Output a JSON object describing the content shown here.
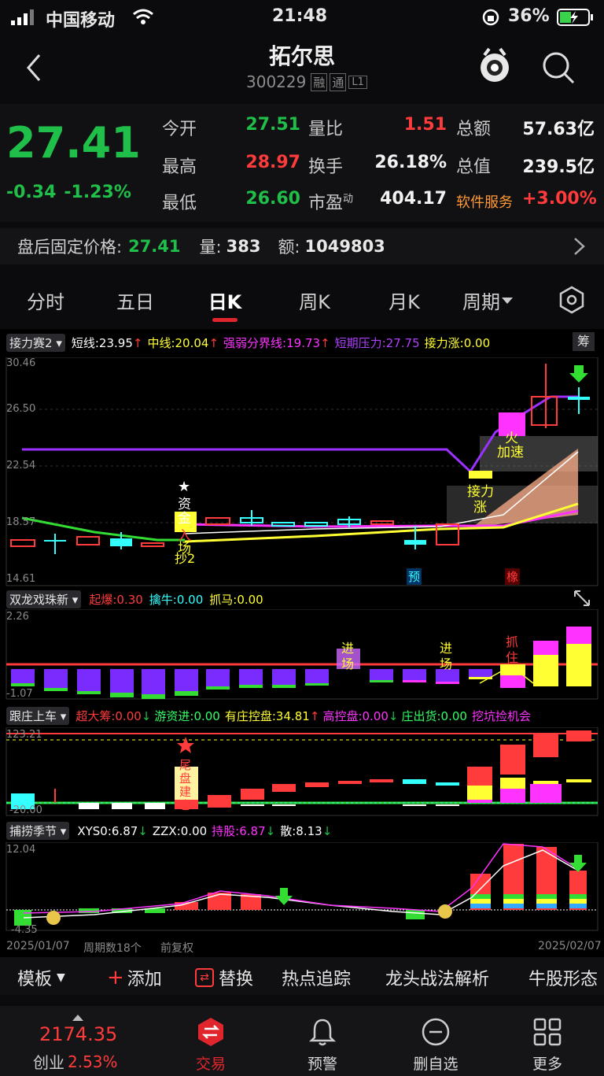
{
  "status_bar": {
    "carrier": "中国移动",
    "time": "21:48",
    "battery": "36%"
  },
  "header": {
    "title": "拓尔思",
    "code": "300229",
    "badges": [
      "融",
      "通",
      "L1"
    ]
  },
  "quote": {
    "price": "27.41",
    "change": "-0.34",
    "change_pct": "-1.23%",
    "fields": [
      {
        "label": "今开",
        "value": "27.51"
      },
      {
        "label": "量比",
        "value": "1.51"
      },
      {
        "label": "总额",
        "value": "57.63亿"
      },
      {
        "label": "最高",
        "value": "28.97"
      },
      {
        "label": "换手",
        "value": "26.18%"
      },
      {
        "label": "总值",
        "value": "239.5亿"
      },
      {
        "label": "最低",
        "value": "26.60"
      },
      {
        "label": "市盈",
        "label_sup": "动",
        "value": "404.17"
      },
      {
        "label": "软件服务",
        "value": "+3.00%"
      }
    ]
  },
  "after_hours": {
    "label": "盘后固定价格:",
    "price": "27.41",
    "vol_label": "量:",
    "vol": "383",
    "amt_label": "额:",
    "amt": "1049803"
  },
  "tabs": [
    "分时",
    "五日",
    "日K",
    "周K",
    "月K",
    "周期"
  ],
  "active_tab": "日K",
  "panel1": {
    "name": "接力赛2",
    "items": [
      {
        "label": "短线:",
        "value": "23.95",
        "arrow": "↑",
        "color": "#ffffff"
      },
      {
        "label": "中线:",
        "value": "20.04",
        "arrow": "↑",
        "color": "#ffff33"
      },
      {
        "label": "强弱分界线:",
        "value": "19.73",
        "arrow": "↑",
        "color": "#ff33ff"
      },
      {
        "label": "短期压力:",
        "value": "27.75",
        "arrow": "",
        "color": "#b040ff"
      },
      {
        "label": "接力涨:",
        "value": "0.00",
        "arrow": "",
        "color": "#ffff33"
      }
    ],
    "button": "筹",
    "y_labels": [
      "30.46",
      "26.50",
      "22.54",
      "18.57",
      "14.61"
    ],
    "annotations": {
      "star": "★",
      "zijin1": "资",
      "zijin2": "金",
      "rule1": "入",
      "rule2": "场",
      "buy": "抄2",
      "jieli1": "接力",
      "jieli2": "涨",
      "jiasu": "加速",
      "jiasu_top": "火",
      "yu": "预",
      "zhen": "橡"
    }
  },
  "panel2": {
    "name": "双龙戏珠新",
    "items": [
      {
        "label": "起爆:",
        "value": "0.30",
        "color": "#ff3b3b"
      },
      {
        "label": "擒牛:",
        "value": "0.00",
        "color": "#33ffff"
      },
      {
        "label": "抓马:",
        "value": "0.00",
        "color": "#ffff33"
      }
    ],
    "y_labels": [
      "2.26",
      "-1.07"
    ],
    "tags": [
      "进",
      "场",
      "进",
      "场",
      "抓",
      "住"
    ]
  },
  "panel3": {
    "name": "跟庄上车",
    "items": [
      {
        "label": "超大筹:",
        "value": "0.00",
        "arrow": "↓",
        "color": "#ff3b3b"
      },
      {
        "label": "游资进:",
        "value": "0.00",
        "arrow": "",
        "color": "#33ff66"
      },
      {
        "label": "有庄控盘:",
        "value": "34.81",
        "arrow": "↑",
        "color": "#ffff33"
      },
      {
        "label": "高控盘:",
        "value": "0.00",
        "arrow": "↓",
        "color": "#ff33ff"
      },
      {
        "label": "庄出货:",
        "value": "0.00",
        "arrow": "",
        "color": "#33ff66"
      },
      {
        "label": "挖坑捡机会",
        "value": "",
        "arrow": "",
        "color": "#ff33ff"
      }
    ],
    "y_labels": [
      "123.21",
      "-20.00"
    ],
    "tag": "尾盘建仓"
  },
  "panel4": {
    "name": "捕捞季节",
    "items": [
      {
        "label": "XYS0:",
        "value": "6.87",
        "arrow": "↓",
        "color": "#ffffff"
      },
      {
        "label": "ZZX:",
        "value": "0.00",
        "arrow": "",
        "color": "#ffffff"
      },
      {
        "label": "持股:",
        "value": "6.87",
        "arrow": "↓",
        "color": "#ff33ff"
      },
      {
        "label": "散:",
        "value": "8.13",
        "arrow": "↓",
        "color": "#ffffff"
      }
    ],
    "y_labels": [
      "12.04",
      "-4.35"
    ]
  },
  "footer_axis": {
    "start": "2025/01/07",
    "count": "周期数18个",
    "adj": "前复权",
    "end": "2025/02/07"
  },
  "toolbar": {
    "template": "模板",
    "add": "添加",
    "replace": "替换",
    "hot": "热点追踪",
    "leader": "龙头战法解析",
    "pattern": "牛股形态"
  },
  "bottom_nav": {
    "index_value": "2174.35",
    "index_name": "创业",
    "index_pct": "2.53%",
    "items": [
      "交易",
      "预警",
      "删自选",
      "更多"
    ]
  },
  "colors": {
    "up": "#ff3b3b",
    "down": "#1fbf4a",
    "accent": "#e0262c"
  }
}
